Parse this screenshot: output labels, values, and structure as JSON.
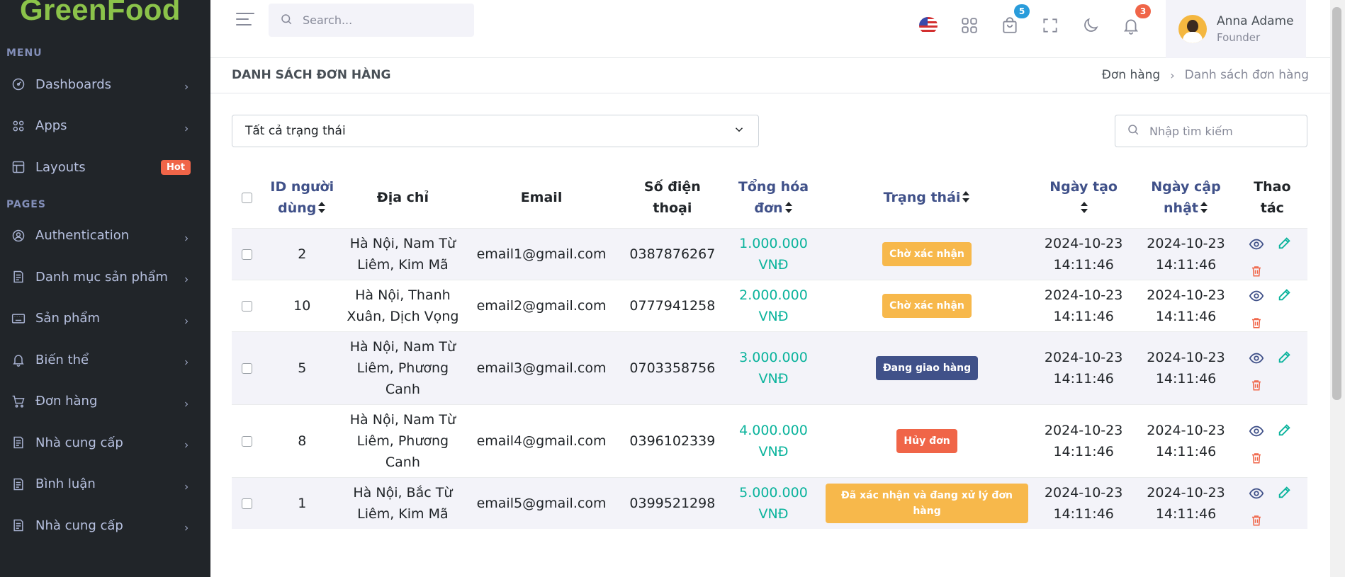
{
  "brand": "GreenFood",
  "sidebar": {
    "menu_title": "MENU",
    "pages_title": "PAGES",
    "menu_items": [
      {
        "label": "Dashboards",
        "icon": "gauge-icon"
      },
      {
        "label": "Apps",
        "icon": "apps-icon"
      },
      {
        "label": "Layouts",
        "icon": "layout-icon",
        "badge": "Hot"
      }
    ],
    "page_items": [
      {
        "label": "Authentication",
        "icon": "user-circle-icon"
      },
      {
        "label": "Danh mục sản phẩm",
        "icon": "file-list-icon"
      },
      {
        "label": "Sản phẩm",
        "icon": "keyboard-icon"
      },
      {
        "label": "Biến thể",
        "icon": "bell-icon"
      },
      {
        "label": "Đơn hàng",
        "icon": "cart-icon"
      },
      {
        "label": "Nhà cung cấp",
        "icon": "file-list-icon"
      },
      {
        "label": "Bình luận",
        "icon": "file-list-icon"
      },
      {
        "label": "Nhà cung cấp",
        "icon": "file-list-icon"
      }
    ]
  },
  "topbar": {
    "search_placeholder": "Search...",
    "cart_badge": "5",
    "notification_badge": "3",
    "user_name": "Anna Adame",
    "user_role": "Founder"
  },
  "page": {
    "title": "DANH SÁCH ĐƠN HÀNG",
    "breadcrumb": [
      "Đơn hàng",
      "Danh sách đơn hàng"
    ]
  },
  "filters": {
    "status_selected": "Tất cả trạng thái",
    "search_placeholder": "Nhập tìm kiếm"
  },
  "table": {
    "headers": {
      "user_id": "ID người dùng",
      "address": "Địa chỉ",
      "email": "Email",
      "phone": "Số điện thoại",
      "total": "Tổng hóa đơn",
      "status": "Trạng thái",
      "created": "Ngày tạo",
      "updated": "Ngày cập nhật",
      "actions": "Thao tác"
    },
    "rows": [
      {
        "user_id": "2",
        "address": "Hà Nội, Nam Từ Liêm, Kim Mã",
        "email": "email1@gmail.com",
        "phone": "0387876267",
        "total": "1.000.000 VNĐ",
        "status": "Chờ xác nhận",
        "status_type": "warning",
        "created": "2024-10-23 14:11:46",
        "updated": "2024-10-23 14:11:46"
      },
      {
        "user_id": "10",
        "address": "Hà Nội, Thanh Xuân, Dịch Vọng",
        "email": "email2@gmail.com",
        "phone": "0777941258",
        "total": "2.000.000 VNĐ",
        "status": "Chờ xác nhận",
        "status_type": "warning",
        "created": "2024-10-23 14:11:46",
        "updated": "2024-10-23 14:11:46"
      },
      {
        "user_id": "5",
        "address": "Hà Nội, Nam Từ Liêm, Phương Canh",
        "email": "email3@gmail.com",
        "phone": "0703358756",
        "total": "3.000.000 VNĐ",
        "status": "Đang giao hàng",
        "status_type": "primary",
        "created": "2024-10-23 14:11:46",
        "updated": "2024-10-23 14:11:46"
      },
      {
        "user_id": "8",
        "address": "Hà Nội, Nam Từ Liêm, Phương Canh",
        "email": "email4@gmail.com",
        "phone": "0396102339",
        "total": "4.000.000 VNĐ",
        "status": "Hủy đơn",
        "status_type": "danger",
        "created": "2024-10-23 14:11:46",
        "updated": "2024-10-23 14:11:46"
      },
      {
        "user_id": "1",
        "address": "Hà Nội, Bắc Từ Liêm, Kim Mã",
        "email": "email5@gmail.com",
        "phone": "0399521298",
        "total": "5.000.000 VNĐ",
        "status": "Đã xác nhận và đang xử lý đơn hàng",
        "status_type": "warning",
        "created": "2024-10-23 14:11:46",
        "updated": "2024-10-23 14:11:46"
      }
    ]
  },
  "colors": {
    "brand": "#8bc34a",
    "sidebar_bg": "#212529",
    "primary": "#405189",
    "success": "#0ab39c",
    "warning": "#f7b84b",
    "danger": "#f06548"
  }
}
